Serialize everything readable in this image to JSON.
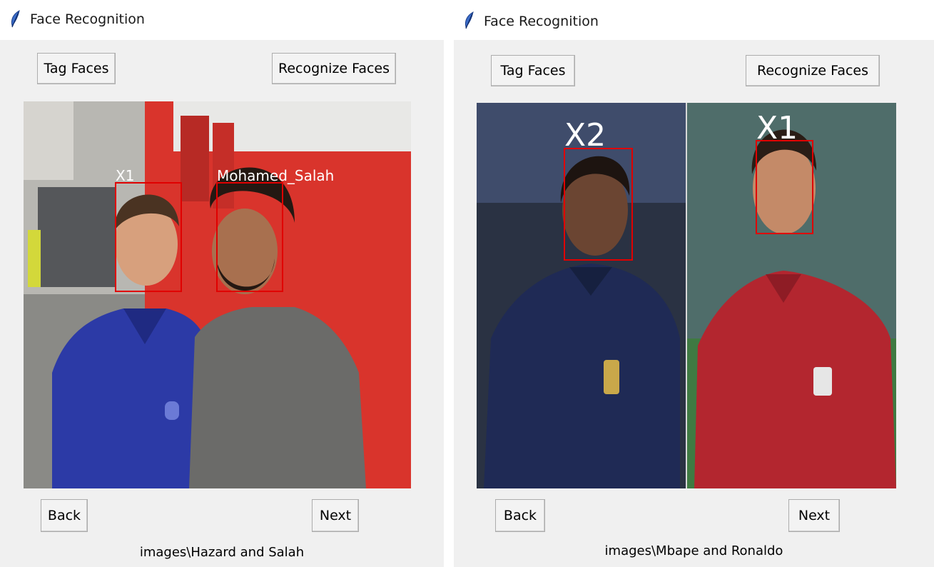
{
  "windows": [
    {
      "title": "Face Recognition",
      "tag_button": "Tag Faces",
      "recognize_button": "Recognize Faces",
      "back_button": "Back",
      "next_button": "Next",
      "image_path": "images\\Hazard and Salah",
      "faces": [
        {
          "label": "X1"
        },
        {
          "label": "Mohamed_Salah"
        }
      ]
    },
    {
      "title": "Face Recognition",
      "tag_button": "Tag Faces",
      "recognize_button": "Recognize Faces",
      "back_button": "Back",
      "next_button": "Next",
      "image_path": "images\\Mbape and Ronaldo",
      "faces": [
        {
          "label": "X2"
        },
        {
          "label": "X1"
        }
      ]
    }
  ],
  "colors": {
    "face_box": "#e00000",
    "window_bg": "#f0f0f0",
    "button_border": "#adadad"
  },
  "icons": {
    "title_icon": "feather-icon"
  }
}
